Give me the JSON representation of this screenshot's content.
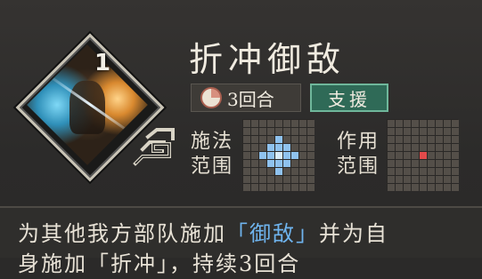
{
  "skill": {
    "level": "1",
    "name": "折冲御敌",
    "rounds": "3回合",
    "category": "支援"
  },
  "ranges": {
    "cast_label_line1": "施法",
    "cast_label_line2": "范围",
    "effect_label_line1": "作用",
    "effect_label_line2": "范围"
  },
  "description": {
    "part1": "为其他我方部队施加",
    "keyword1": "「御敌」",
    "part2": "并为自",
    "line2": "身施加「折冲」，持续3回合"
  },
  "colors": {
    "keyword": "#6fb4ee",
    "support_tag": "#2f6a57",
    "effect_cell": "#e24a4a",
    "cast_cell": "#8fc2ee"
  }
}
